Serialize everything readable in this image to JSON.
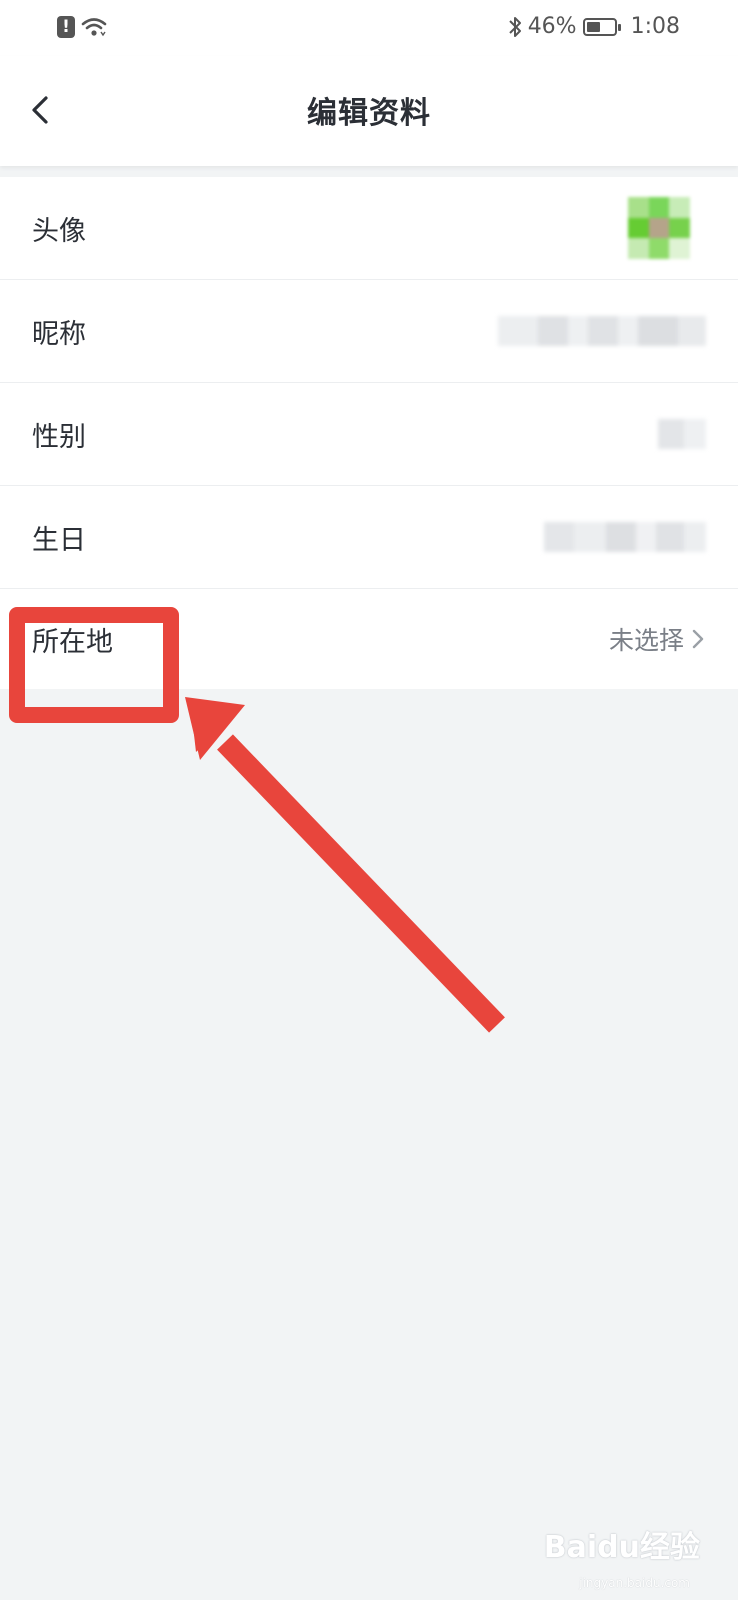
{
  "status_bar": {
    "battery": "46%",
    "time": "1:08",
    "icons": [
      "alert-icon",
      "wifi-icon",
      "bluetooth-icon",
      "battery-icon"
    ]
  },
  "nav": {
    "title": "编辑资料",
    "back_icon": "chevron-left-icon"
  },
  "profile_rows": [
    {
      "label": "头像",
      "value": ""
    },
    {
      "label": "昵称",
      "value": ""
    },
    {
      "label": "性别",
      "value": ""
    },
    {
      "label": "生日",
      "value": ""
    },
    {
      "label": "所在地",
      "value": "未选择"
    }
  ],
  "annotation": {
    "color": "#e8453c"
  },
  "watermark": {
    "text": "Baidu经验",
    "sub": "jingyan.baidu.com"
  }
}
